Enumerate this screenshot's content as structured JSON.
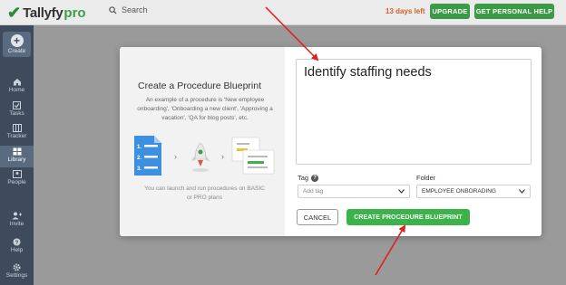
{
  "header": {
    "brand": "Tallyfy",
    "brand_suffix": "pro",
    "search_label": "Search",
    "trial_text": "13 days left",
    "upgrade_label": "UPGRADE",
    "personal_help_label": "GET PERSONAL HELP"
  },
  "sidebar": {
    "create_label": "Create",
    "items": [
      {
        "label": "Home",
        "icon": "home-icon"
      },
      {
        "label": "Tasks",
        "icon": "tasks-icon"
      },
      {
        "label": "Tracker",
        "icon": "tracker-icon"
      },
      {
        "label": "Library",
        "icon": "library-icon"
      },
      {
        "label": "People",
        "icon": "people-icon"
      },
      {
        "label": "Invite",
        "icon": "invite-icon"
      },
      {
        "label": "Help",
        "icon": "help-icon"
      },
      {
        "label": "Settings",
        "icon": "settings-icon"
      }
    ]
  },
  "modal": {
    "heading": "Create a Procedure Blueprint",
    "description": "An example of a procedure is 'New employee onboarding', 'Onboarding a new client', 'Approving a vacation', 'QA for blog posts', etc.",
    "note": "You can launch and run procedures on BASIC or PRO plans",
    "title_value": "Identify staffing needs",
    "tag_label": "Tag",
    "tag_placeholder": "Add tag",
    "folder_label": "Folder",
    "folder_value": "EMPLOYEE ONBORADING",
    "cancel_label": "CANCEL",
    "create_label": "CREATE PROCEDURE BLUEPRINT"
  },
  "colors": {
    "accent_green": "#3bb24a",
    "sidebar_bg": "#3e4b5c",
    "trial_orange": "#d0632a",
    "annotation_red": "#e01f1f"
  }
}
